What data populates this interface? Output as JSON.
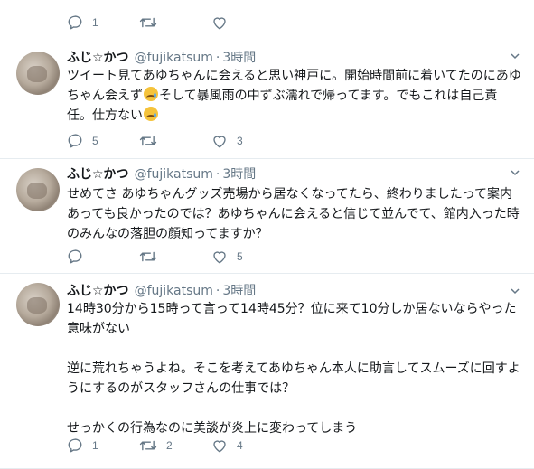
{
  "top_actions": {
    "reply_count": "1",
    "retweet_count": "",
    "like_count": ""
  },
  "tweets": [
    {
      "name": "ふじ☆かつ",
      "handle": "@fujikatsum",
      "dot": "·",
      "time": "3時間",
      "paragraphs": [
        {
          "before": "ツイート見てあゆちゃんに会えると思い神戸に。開始時間前に着いてたのにあゆちゃん会えず",
          "mid": "そして暴風雨の中ずぶ濡れで帰ってます。でもこれは自己責任。仕方ない",
          "after": ""
        }
      ],
      "reply_count": "5",
      "retweet_count": "",
      "like_count": "3"
    },
    {
      "name": "ふじ☆かつ",
      "handle": "@fujikatsum",
      "dot": "·",
      "time": "3時間",
      "paragraphs": [
        {
          "text": "せめてさ あゆちゃんグッズ売場から居なくなってたら、終わりましたって案内あっても良かったのでは？あゆちゃんに会えると信じて並んでて、館内入った時のみんなの落胆の顔知ってますか？"
        }
      ],
      "reply_count": "",
      "retweet_count": "",
      "like_count": "5"
    },
    {
      "name": "ふじ☆かつ",
      "handle": "@fujikatsum",
      "dot": "·",
      "time": "3時間",
      "paragraphs": [
        {
          "text": "14時30分から15時って言って14時45分？位に来て10分しか居ないならやった意味がない"
        },
        {
          "text": "逆に荒れちゃうよね。そこを考えてあゆちゃん本人に助言してスムーズに回すようにするのがスタッフさんの仕事では？"
        },
        {
          "text": "せっかくの行為なのに美談が炎上に変わってしまう"
        }
      ],
      "reply_count": "1",
      "retweet_count": "2",
      "like_count": "4"
    }
  ],
  "icons": {
    "reply": "reply-icon",
    "retweet": "retweet-icon",
    "like": "heart-icon",
    "caret": "chevron-down-icon",
    "emoji": "crying-face-emoji"
  },
  "colors": {
    "icon": "#657786",
    "divider": "#e6ecf0",
    "text": "#14171a"
  }
}
